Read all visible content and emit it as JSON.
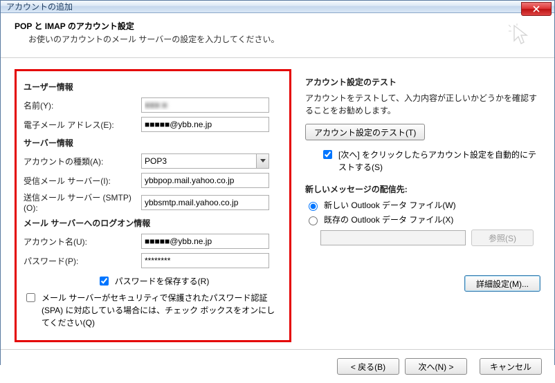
{
  "window": {
    "title": "アカウントの追加",
    "close": "×"
  },
  "header": {
    "title": "POP と IMAP のアカウント設定",
    "subtitle": "お使いのアカウントのメール サーバーの設定を入力してください。"
  },
  "left": {
    "userinfo_h": "ユーザー情報",
    "name_label": "名前(Y):",
    "name_value": "■■■ ■",
    "email_label": "電子メール アドレス(E):",
    "email_value": "■■■■■@ybb.ne.jp",
    "serverinfo_h": "サーバー情報",
    "accounttype_label": "アカウントの種類(A):",
    "accounttype_value": "POP3",
    "incoming_label": "受信メール サーバー(I):",
    "incoming_value": "ybbpop.mail.yahoo.co.jp",
    "outgoing_label": "送信メール サーバー (SMTP)(O):",
    "outgoing_value": "ybbsmtp.mail.yahoo.co.jp",
    "logon_h": "メール サーバーへのログオン情報",
    "acctname_label": "アカウント名(U):",
    "acctname_value": "■■■■■@ybb.ne.jp",
    "password_label": "パスワード(P):",
    "password_value": "********",
    "remember_label": "パスワードを保存する(R)",
    "spa_label": "メール サーバーがセキュリティで保護されたパスワード認証 (SPA) に対応している場合には、チェック ボックスをオンにしてください(Q)"
  },
  "right": {
    "test_h": "アカウント設定のテスト",
    "test_desc": "アカウントをテストして、入力内容が正しいかどうかを確認することをお勧めします。",
    "test_btn": "アカウント設定のテスト(T)",
    "autotest_label": "[次へ] をクリックしたらアカウント設定を自動的にテストする(S)",
    "deliver_h": "新しいメッセージの配信先:",
    "radio_new": "新しい Outlook データ ファイル(W)",
    "radio_existing": "既存の Outlook データ ファイル(X)",
    "browse_btn": "参照(S)",
    "advanced_btn": "詳細設定(M)..."
  },
  "footer": {
    "back": "< 戻る(B)",
    "next": "次へ(N) >",
    "cancel": "キャンセル"
  }
}
